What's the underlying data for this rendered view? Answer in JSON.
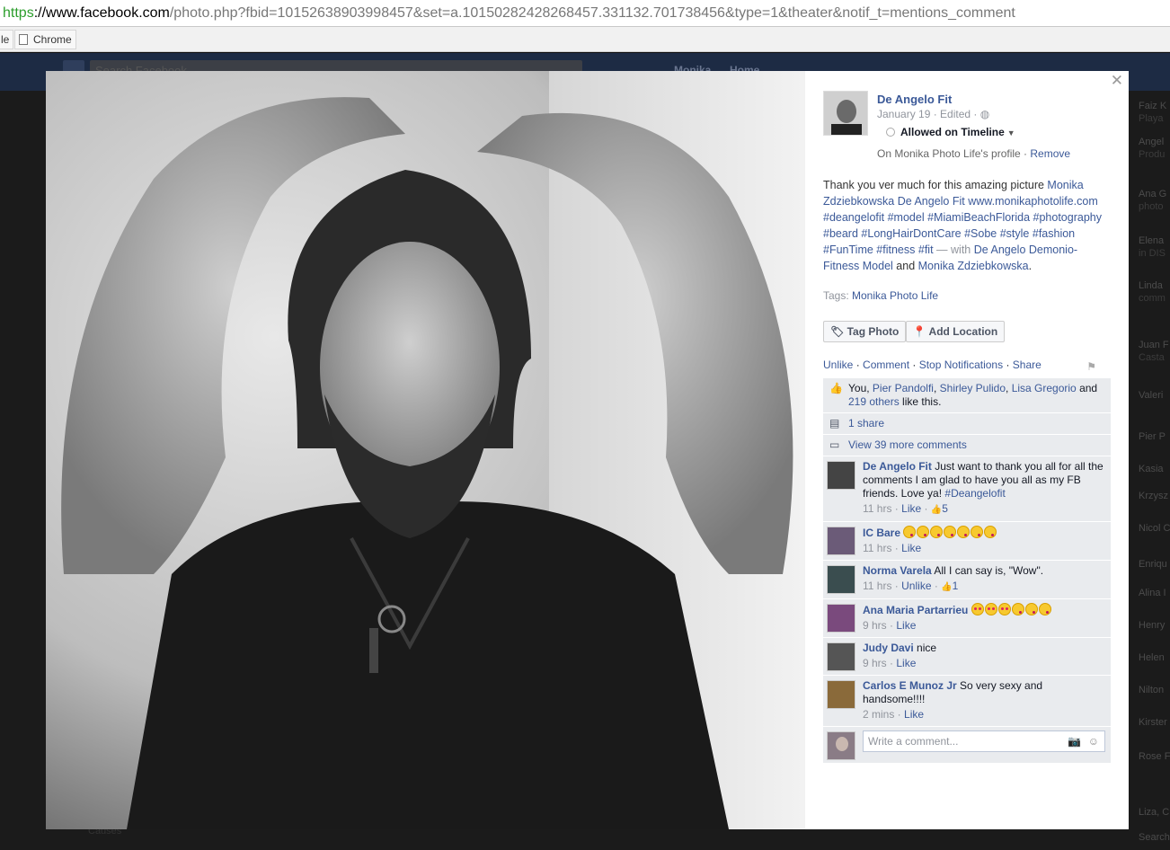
{
  "browser": {
    "url_scheme": "https",
    "url_host": "://www.facebook.com",
    "url_rest": "/photo.php?fbid=10152638903998457&set=a.10150282428268457.331132.701738456&type=1&theater&notif_t=mentions_comment",
    "bookmarks": [
      "le",
      "Chrome"
    ]
  },
  "fb_background": {
    "search_placeholder": "Search Facebook",
    "nav": [
      "Monika",
      "Home"
    ],
    "chat_names": [
      {
        "name": "Faiz K",
        "sub": "Playa"
      },
      {
        "name": "Angel",
        "sub": "Produ"
      },
      {
        "name": "Ana G",
        "sub": "photo"
      },
      {
        "name": "Elena",
        "sub": "in DIS"
      },
      {
        "name": "Linda",
        "sub": "comm"
      },
      {
        "name": "Juan F",
        "sub": "Casta"
      },
      {
        "name": "Valeri",
        "sub": ""
      },
      {
        "name": "Pier P",
        "sub": ""
      },
      {
        "name": "Kasia",
        "sub": ""
      },
      {
        "name": "Krzysz",
        "sub": ""
      },
      {
        "name": "Nicol C",
        "sub": ""
      },
      {
        "name": "Enriqu",
        "sub": ""
      },
      {
        "name": "Alina I",
        "sub": ""
      },
      {
        "name": "Henry",
        "sub": ""
      },
      {
        "name": "Helen",
        "sub": ""
      },
      {
        "name": "Nilton",
        "sub": ""
      },
      {
        "name": "Kirster",
        "sub": ""
      },
      {
        "name": "Rose F",
        "sub": ""
      },
      {
        "name": "Liza, C",
        "sub": ""
      },
      {
        "name": "Search",
        "sub": ""
      }
    ],
    "bottom_text": "Causes"
  },
  "post": {
    "author": "De Angelo Fit",
    "date": "January 19",
    "edited": "Edited",
    "timeline_status": "Allowed on Timeline",
    "profile_note": "On Monika Photo Life's profile",
    "remove_label": "Remove",
    "caption_prefix": "Thank you ver much for this amazing picture ",
    "mention1": "Monika Zdziebkowska",
    "mention2": "De Angelo Fit",
    "website": "www.monikaphotolife.com",
    "hashtags": [
      "#deangelofit",
      "#model",
      "#MiamiBeachFlorida",
      "#photography",
      "#beard",
      "#LongHairDontCare",
      "#Sobe",
      "#style",
      "#fashion",
      "#FunTime",
      "#fitness",
      "#fit"
    ],
    "with_text": " — with ",
    "with1": "De Angelo Demonio-Fitness Model",
    "and_text": " and ",
    "with2": "Monika Zdziebkowska",
    "tags_label": "Tags: ",
    "tag1": "Monika Photo Life",
    "tag_photo_label": "Tag Photo",
    "add_location_label": "Add Location",
    "actions": [
      "Unlike",
      "Comment",
      "Stop Notifications",
      "Share"
    ],
    "likes_prefix": "You, ",
    "likers": [
      "Pier Pandolfi",
      "Shirley Pulido",
      "Lisa Gregorio"
    ],
    "likes_and": " and ",
    "likes_others": "219 others",
    "likes_suffix": " like this.",
    "shares": "1 share",
    "view_more": "View 39 more comments",
    "write_placeholder": "Write a comment..."
  },
  "comments": [
    {
      "name": "De Angelo Fit",
      "text": "Just want to thank you all for all the comments I am glad to have you all as my FB friends. Love ya! ",
      "hashtag": "#Deangelofit",
      "emoji": [],
      "time": "11 hrs",
      "action": "Like",
      "likes": "5",
      "avatar_color": "#444"
    },
    {
      "name": "IC Bare",
      "text": "",
      "hashtag": "",
      "emoji": [
        "kiss",
        "kiss",
        "kiss",
        "kiss",
        "kiss",
        "kiss",
        "kiss"
      ],
      "time": "11 hrs",
      "action": "Like",
      "likes": "",
      "avatar_color": "#6b5b78"
    },
    {
      "name": "Norma Varela",
      "text": "All I can say is, \"Wow\".",
      "hashtag": "",
      "emoji": [],
      "time": "11 hrs",
      "action": "Unlike",
      "likes": "1",
      "avatar_color": "#3a4d4f"
    },
    {
      "name": "Ana Maria Partarrieu",
      "text": "",
      "hashtag": "",
      "emoji": [
        "heart",
        "heart",
        "heart",
        "kiss",
        "kiss",
        "kiss"
      ],
      "time": "9 hrs",
      "action": "Like",
      "likes": "",
      "avatar_color": "#7a4a7d"
    },
    {
      "name": "Judy Davi",
      "text": "nice",
      "hashtag": "",
      "emoji": [],
      "time": "9 hrs",
      "action": "Like",
      "likes": "",
      "avatar_color": "#555"
    },
    {
      "name": "Carlos E Munoz Jr",
      "text": "So very sexy and handsome!!!!",
      "hashtag": "",
      "emoji": [],
      "time": "2 mins",
      "action": "Like",
      "likes": "",
      "avatar_color": "#8a6a3a"
    }
  ]
}
